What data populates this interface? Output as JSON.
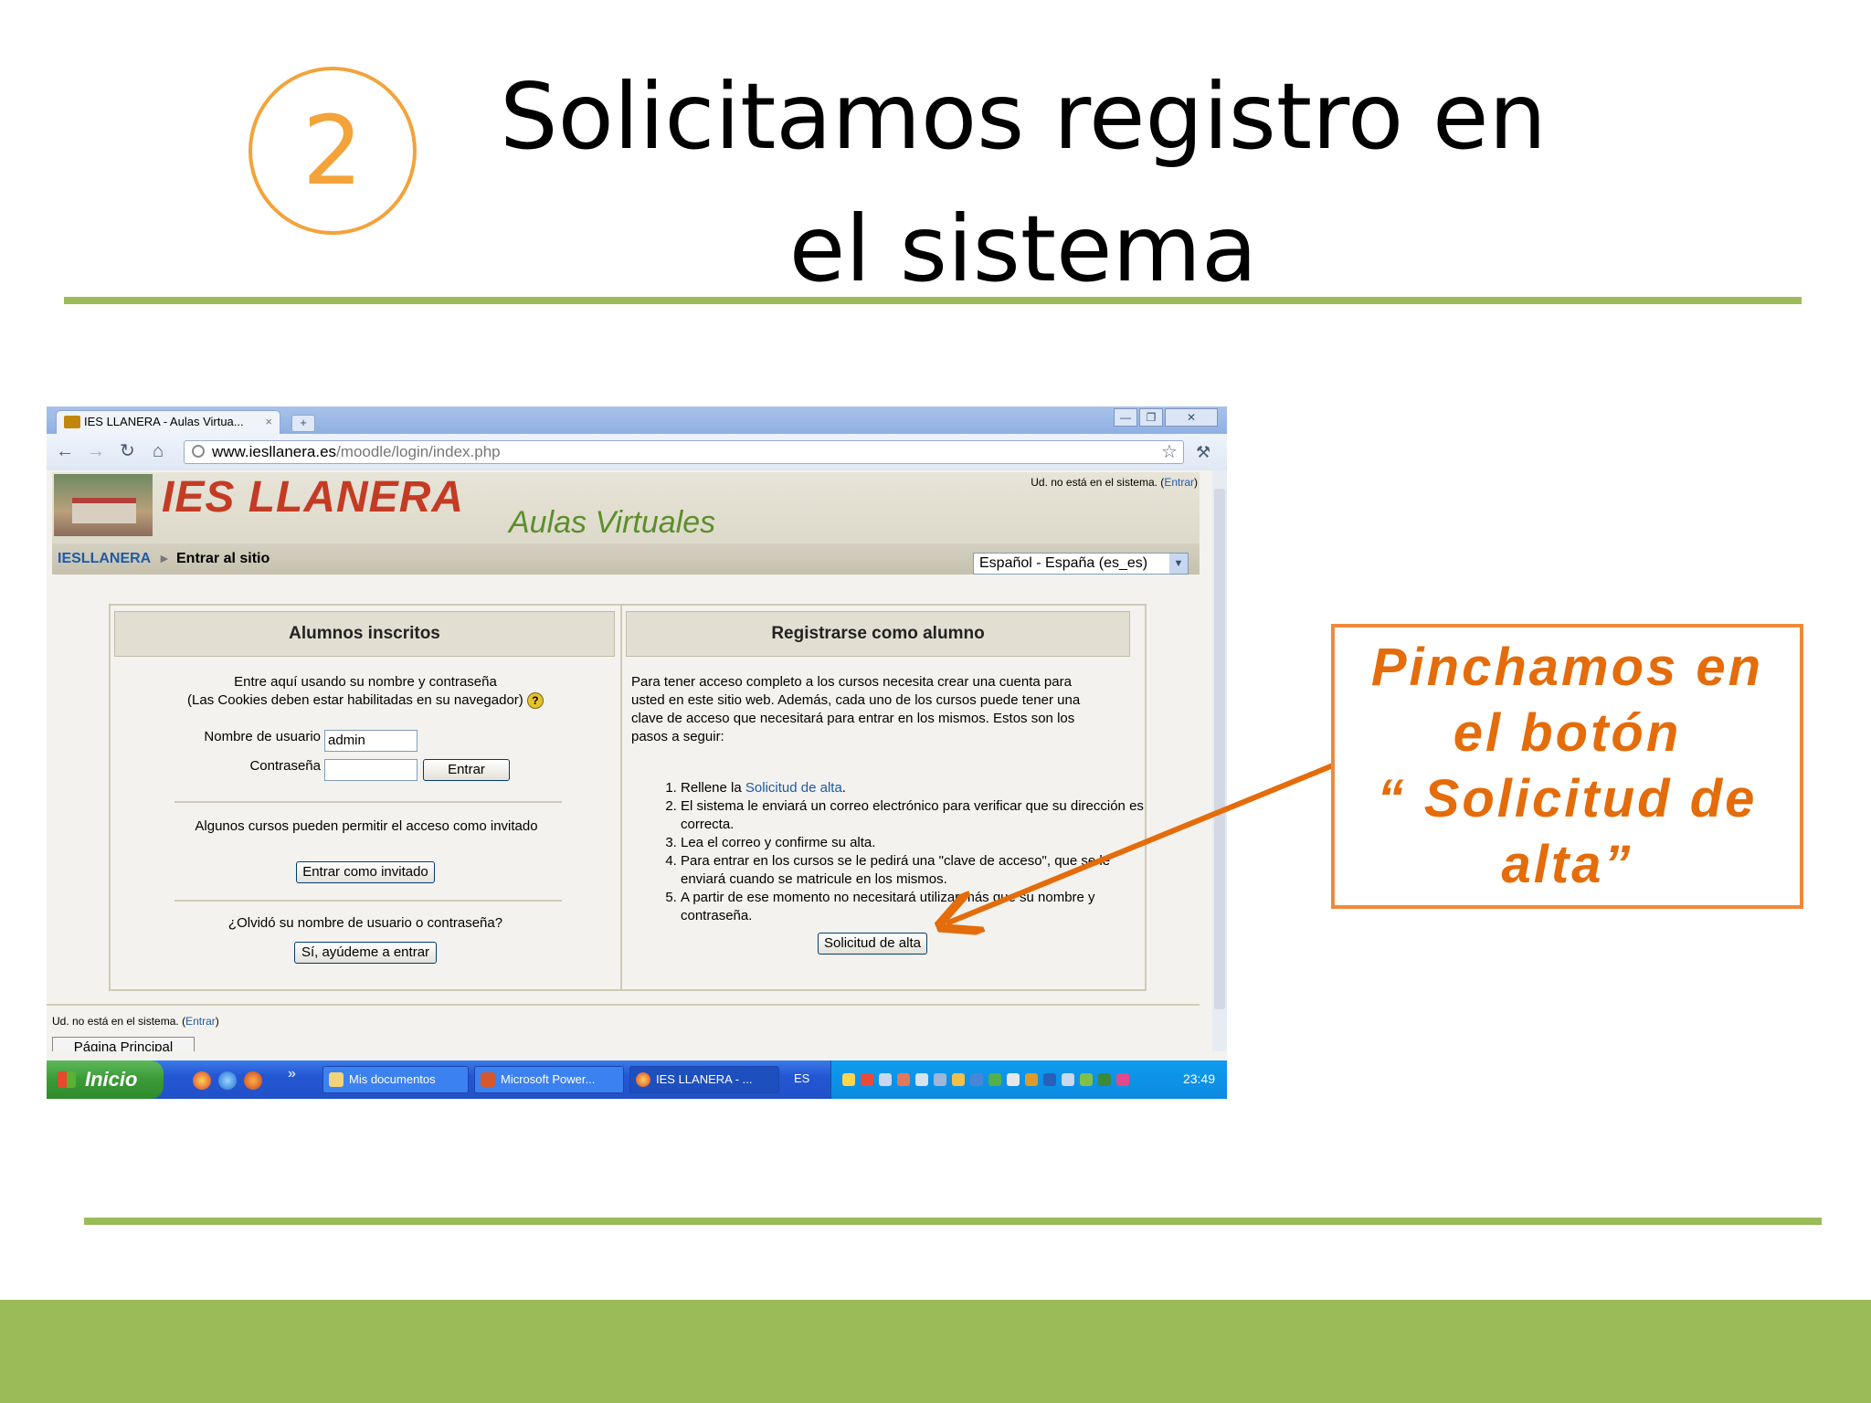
{
  "slide": {
    "step_number": "2",
    "title": "Solicitamos registro en el sistema",
    "callout": "Pinchamos en\nel botón\n“ Solicitud de\nalta”",
    "colors": {
      "accent_green": "#9bbb59",
      "accent_orange": "#f0893a",
      "step_orange": "#f3a33a"
    }
  },
  "browser": {
    "tab_title": "IES LLANERA - Aulas Virtua...",
    "tab_close": "×",
    "newtab": "+",
    "window_controls": [
      "—",
      "❐",
      "✕"
    ],
    "url_domain": "www.iesllanera.es",
    "url_path": "/moodle/login/index.php",
    "icons": [
      "back-arrow-icon",
      "forward-arrow-icon",
      "reload-icon",
      "home-icon",
      "star-icon",
      "wrench-icon"
    ]
  },
  "site": {
    "logo": "IES LLANERA",
    "subtitle": "Aulas Virtuales",
    "login_info_prefix": "Ud. no está en el sistema. (",
    "login_link": "Entrar",
    "login_info_suffix": ")",
    "breadcrumb_home": "IESLLANERA",
    "breadcrumb_sep": "►",
    "breadcrumb_current": "Entrar al sitio",
    "language": "Español - España (es_es)"
  },
  "left_panel": {
    "heading": "Alumnos inscritos",
    "intro_line1": "Entre aquí usando su nombre y contraseña",
    "intro_line2": "(Las Cookies deben estar habilitadas en su navegador)",
    "help_glyph": "?",
    "username_label": "Nombre de usuario",
    "username_value": "admin",
    "password_label": "Contraseña",
    "password_value": "",
    "login_button": "Entrar",
    "guest_text": "Algunos cursos pueden permitir el acceso como invitado",
    "guest_button": "Entrar como invitado",
    "forgot_text": "¿Olvidó su nombre de usuario o contraseña?",
    "forgot_button": "Sí, ayúdeme a entrar"
  },
  "right_panel": {
    "heading": "Registrarse como alumno",
    "intro": "Para tener acceso completo a los cursos necesita crear una cuenta para usted en este sitio web. Además, cada uno de los cursos puede tener una clave de acceso que necesitará para entrar en los mismos. Estos son los pasos a seguir:",
    "step1_prefix": "Rellene la ",
    "step1_link": "Solicitud de alta",
    "step1_suffix": ".",
    "step2": "El sistema le enviará un correo electrónico para verificar que su dirección es correcta.",
    "step3": "Lea el correo y confirme su alta.",
    "step4": "Para entrar en los cursos se le pedirá una \"clave de acceso\", que se le enviará cuando se matricule en los mismos.",
    "step5": "A partir de ese momento no necesitará utilizar más que su nombre y contraseña.",
    "signup_button": "Solicitud de alta"
  },
  "page_footer": {
    "login_info_prefix": "Ud. no está en el sistema. (",
    "login_link": "Entrar",
    "login_info_suffix": ")",
    "home_button": "Página Principal"
  },
  "taskbar": {
    "start_label": "Inicio",
    "chevron": "»",
    "tasks": [
      "Mis documentos",
      "Microsoft Power...",
      "IES LLANERA - ..."
    ],
    "language": "ES",
    "clock": "23:49"
  }
}
